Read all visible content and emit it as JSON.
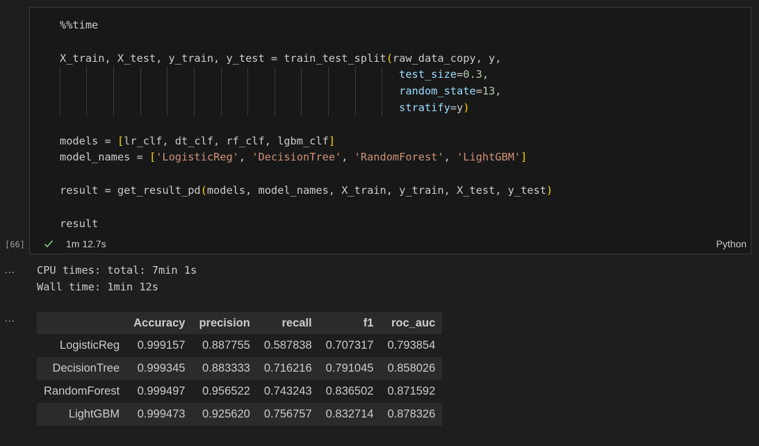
{
  "cell": {
    "execution_count": "[66]",
    "status_time": "1m 12.7s",
    "language": "Python",
    "code": {
      "line1": "%%time",
      "line2": {
        "lhs": "X_train, X_test, y_train, y_test = train_test_split",
        "open": "(",
        "args": "raw_data_copy, y,"
      },
      "line3": {
        "param": "test_size",
        "eq": "=",
        "value": "0.3",
        "tail": ","
      },
      "line4": {
        "param": "random_state",
        "eq": "=",
        "value": "13",
        "tail": ","
      },
      "line5": {
        "param": "stratify",
        "eq": "=",
        "value": "y",
        "close": ")"
      },
      "line6": {
        "lhs": "models = ",
        "open": "[",
        "items": "lr_clf, dt_clf, rf_clf, lgbm_clf",
        "close": "]"
      },
      "line7": {
        "lhs": "model_names = ",
        "open": "[",
        "s1": "'LogisticReg'",
        "s2": "'DecisionTree'",
        "s3": "'RandomForest'",
        "s4": "'LightGBM'",
        "sep": ", ",
        "close": "]"
      },
      "line8": {
        "lhs": "result = get_result_pd",
        "open": "(",
        "args": "models, model_names, X_train, y_train, X_test, y_test",
        "close": ")"
      },
      "line9": "result"
    }
  },
  "output": {
    "more_label": "...",
    "stdout_line1": "CPU times: total: 7min 1s",
    "stdout_line2": "Wall time: 1min 12s",
    "table": {
      "columns": [
        "",
        "Accuracy",
        "precision",
        "recall",
        "f1",
        "roc_auc"
      ],
      "rows": [
        {
          "index": "LogisticReg",
          "values": [
            "0.999157",
            "0.887755",
            "0.587838",
            "0.707317",
            "0.793854"
          ]
        },
        {
          "index": "DecisionTree",
          "values": [
            "0.999345",
            "0.883333",
            "0.716216",
            "0.791045",
            "0.858026"
          ]
        },
        {
          "index": "RandomForest",
          "values": [
            "0.999497",
            "0.956522",
            "0.743243",
            "0.836502",
            "0.871592"
          ]
        },
        {
          "index": "LightGBM",
          "values": [
            "0.999473",
            "0.925620",
            "0.756757",
            "0.832714",
            "0.878326"
          ]
        }
      ]
    }
  },
  "icons": {
    "status": "check-icon",
    "more": "ellipsis-icon"
  },
  "colors": {
    "background": "#1e1e1e",
    "cell_background": "#181818",
    "cell_border": "#3a3a3a",
    "bracket_level1": "#ffd700",
    "bracket_level2": "#da70d6",
    "parameter": "#9cdcfe",
    "number": "#b5cea8",
    "string": "#ce9178",
    "success_check": "#89d185",
    "table_stripe": "#2b2b2b"
  }
}
